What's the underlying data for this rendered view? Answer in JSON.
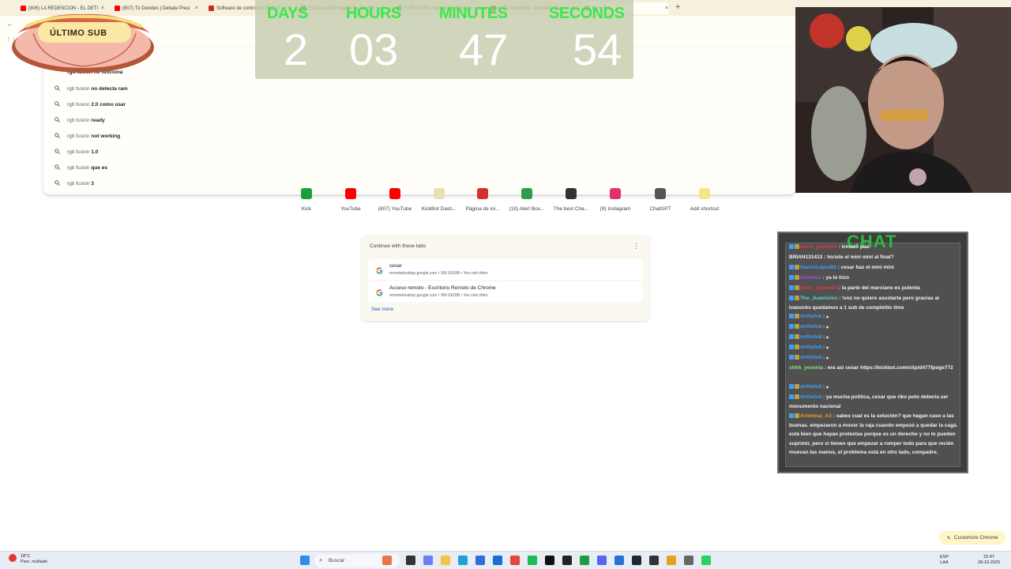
{
  "tabs": [
    {
      "label": "(806) LA REDENCION - EL DETI",
      "color": "#ff0000"
    },
    {
      "label": "(807) Tú Decides | Debate Presi",
      "color": "#ff0000"
    },
    {
      "label": "Software de control de RGB K",
      "color": "#c62828"
    },
    {
      "label": "ElCesarLIVE clipped by SaintM",
      "color": "#2e7d32"
    },
    {
      "label": "FURY CTRL: descarga e instala",
      "color": "#43a047"
    },
    {
      "label": "(807) Mini Mini - Punto40, Ma",
      "color": "#ff0000"
    },
    {
      "label": "New Tab",
      "color": "#9e9e9e"
    }
  ],
  "omnibox": {
    "partial_suggestion": "rgb fusion no funciona",
    "suggestions": [
      {
        "prefix": "rgb fusion",
        "rest": "no detecta ram"
      },
      {
        "prefix": "rgb fusion",
        "rest": "2.0 como usar"
      },
      {
        "prefix": "rgb fusion",
        "rest": "ready"
      },
      {
        "prefix": "rgb fusion",
        "rest": "not working"
      },
      {
        "prefix": "rgb fusion",
        "rest": "1.0"
      },
      {
        "prefix": "rgb fusion",
        "rest": "que es"
      },
      {
        "prefix": "rgb fusion",
        "rest": "3"
      }
    ]
  },
  "shortcuts": [
    {
      "label": "Kick",
      "color": "#1b9e3e"
    },
    {
      "label": "YouTube",
      "color": "#ff0000"
    },
    {
      "label": "(807) YouTube",
      "color": "#ff0000"
    },
    {
      "label": "KickBot Dash...",
      "color": "#e8e0b0"
    },
    {
      "label": "Página de ini...",
      "color": "#d32f2f"
    },
    {
      "label": "(18) Alert Box...",
      "color": "#2e9b4e"
    },
    {
      "label": "The best Cha...",
      "color": "#333333"
    },
    {
      "label": "(9) Instagram",
      "color": "#e1306c"
    },
    {
      "label": "ChatGPT",
      "color": "#555555"
    },
    {
      "label": "Add shortcut",
      "color": "#f5e58a"
    }
  ],
  "continue_card": {
    "title": "Continue with these tabs",
    "items": [
      {
        "title": "cesar",
        "subtitle": "remotedesktop.google.com • SM-S918B • You visit often"
      },
      {
        "title": "Acceso remoto - Escritorio Remoto de Chrome",
        "subtitle": "remotedesktop.google.com • SM-S918B • You visit often"
      }
    ],
    "see_more": "See more"
  },
  "countdown": {
    "days_label": "DAYS",
    "days": "2",
    "hours_label": "HOURS",
    "hours": "03",
    "minutes_label": "MINUTES",
    "minutes": "47",
    "seconds_label": "SECONDS",
    "seconds": "54"
  },
  "overlay": {
    "ultimo_sub": "ÚLTIMO SUB"
  },
  "chat": {
    "title": "CHAT",
    "messages": [
      {
        "user": "black_gamer04",
        "user_color": "#e53935",
        "text": ": trmazo paa"
      },
      {
        "user": "BRIAN131413",
        "user_color": "#f4f4f4",
        "text": ": hiciste el mini mini al final?"
      },
      {
        "user": "NachoLopez69",
        "user_color": "#3aa1ff",
        "text": ": cesar haz el mini mini"
      },
      {
        "user": "luisitoo1",
        "user_color": "#b04ae0",
        "text": ": ya lo hizo"
      },
      {
        "user": "black_gamer04",
        "user_color": "#e53935",
        "text": ": la parte del marciano es pulenta"
      },
      {
        "user": "The_Juanisimo",
        "user_color": "#5ecde0",
        "text": ": !voz no quiero asustarte pero gracias al ivanocks quedamos a 1 sub de completito time"
      },
      {
        "user": "mrflo0x8",
        "user_color": "#3aa1ff",
        "text": ": ⁎"
      },
      {
        "user": "mrflo0x8",
        "user_color": "#3aa1ff",
        "text": ": ⁎"
      },
      {
        "user": "mrflo0x8",
        "user_color": "#3aa1ff",
        "text": ": ⁎"
      },
      {
        "user": "mrflo0x8",
        "user_color": "#3aa1ff",
        "text": ": ⁎"
      },
      {
        "user": "mrflo0x8",
        "user_color": "#3aa1ff",
        "text": ": ⁎"
      },
      {
        "user": "shhh_yesenia",
        "user_color": "#7ee87e",
        "text": ": era asi cesar https://kickbot.com/clip/d477fpoge772"
      },
      {
        "user": "mrflo0x8",
        "user_color": "#3aa1ff",
        "text": ": ⁎"
      },
      {
        "user": "mrflo0x8",
        "user_color": "#3aa1ff",
        "text": ": ya mucha politica, cesar que riko poto deberia ser monumento nacional"
      },
      {
        "user": "Artemisa_A3",
        "user_color": "#f29b2a",
        "text": ": sabes cual es la solución? que hagan caso a las buenas. empezaron a mover la raja cuando empezó a quedar la cagá. está bien que hayan protestas porque es un derecho y no lo pueden suprimir, pero si tienen que empezar a romper todo para que recién muevan las manos, el problema está en otro lado, compadre."
      }
    ]
  },
  "customize_chrome": "Customize Chrome",
  "taskbar": {
    "temp": "18°C",
    "weather": "Parc. nublado",
    "search_placeholder": "Buscar",
    "lang_top": "ESP",
    "lang_bottom": "LAA",
    "time": "22:47",
    "date": "28-10-2025"
  }
}
